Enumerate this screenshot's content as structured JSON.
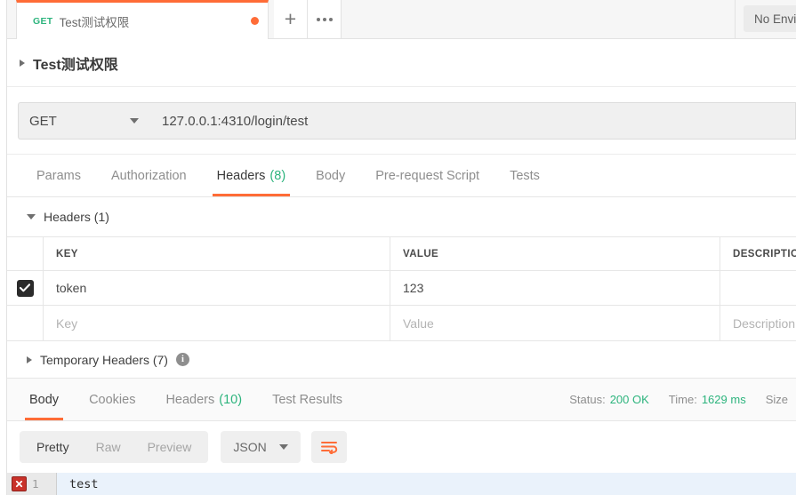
{
  "tabbar": {
    "request_tab": {
      "method": "GET",
      "title": "Test测试权限",
      "unsaved": true
    },
    "new_tab_label": "+",
    "more_label": "•••",
    "environment": "No Environment"
  },
  "breadcrumb": {
    "title": "Test测试权限"
  },
  "urlbar": {
    "method": "GET",
    "url": "127.0.0.1:4310/login/test"
  },
  "request_tabs": [
    {
      "label": "Params",
      "count": "",
      "active": false
    },
    {
      "label": "Authorization",
      "count": "",
      "active": false
    },
    {
      "label": "Headers",
      "count": "(8)",
      "active": true
    },
    {
      "label": "Body",
      "count": "",
      "active": false
    },
    {
      "label": "Pre-request Script",
      "count": "",
      "active": false
    },
    {
      "label": "Tests",
      "count": "",
      "active": false
    }
  ],
  "headers_section": {
    "title": "Headers (1)",
    "columns": {
      "key": "KEY",
      "value": "VALUE",
      "description": "DESCRIPTION"
    },
    "rows": [
      {
        "checked": true,
        "key": "token",
        "value": "123",
        "description": ""
      }
    ],
    "placeholder_row": {
      "key": "Key",
      "value": "Value",
      "description": "Description"
    }
  },
  "temporary_headers": {
    "title": "Temporary Headers (7)",
    "info_icon": "info-icon"
  },
  "response": {
    "tabs": [
      {
        "label": "Body",
        "count": "",
        "active": true
      },
      {
        "label": "Cookies",
        "count": "",
        "active": false
      },
      {
        "label": "Headers",
        "count": "(10)",
        "active": false
      },
      {
        "label": "Test Results",
        "count": "",
        "active": false
      }
    ],
    "status_label": "Status:",
    "status_value": "200 OK",
    "time_label": "Time:",
    "time_value": "1629 ms",
    "size_label": "Size"
  },
  "body_viewer": {
    "modes": [
      {
        "label": "Pretty",
        "active": true
      },
      {
        "label": "Raw",
        "active": false
      },
      {
        "label": "Preview",
        "active": false
      }
    ],
    "format": "JSON",
    "wrap_icon": "word-wrap-icon",
    "lines": [
      {
        "number": "1",
        "text": "test",
        "error": true
      }
    ]
  },
  "colors": {
    "accent": "#ff6c37",
    "green": "#2db47d",
    "error": "#c9322a",
    "line_highlight": "#eaf2fb"
  }
}
